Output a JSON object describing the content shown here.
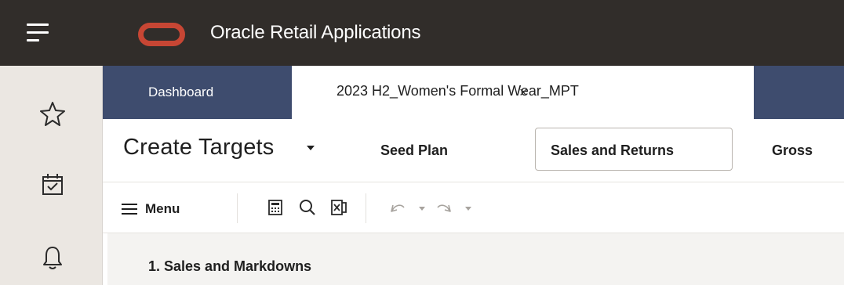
{
  "header": {
    "app_title": "Oracle Retail Applications",
    "menu_icon": "hamburger-icon",
    "logo_icon": "oracle-logo",
    "background": "#312d2a",
    "logo_color": "#c74634"
  },
  "siderail": {
    "items": [
      {
        "icon": "star-icon",
        "label": "Favorites"
      },
      {
        "icon": "calendar-check-icon",
        "label": "Tasks"
      },
      {
        "icon": "bell-icon",
        "label": "Notifications"
      }
    ]
  },
  "tabs": {
    "items": [
      {
        "label": "Dashboard",
        "active": false
      },
      {
        "label": "2023 H2_Women's Formal Wear_MPT",
        "active": true,
        "close": "×"
      }
    ],
    "bar_color": "#3e4c6e"
  },
  "stage": {
    "title": "Create Targets",
    "steps": [
      {
        "label": "Seed Plan",
        "selected": false
      },
      {
        "label": "Sales and Returns",
        "selected": true
      },
      {
        "label": "Gross",
        "selected": false
      }
    ]
  },
  "toolbar": {
    "menu_label": "Menu",
    "icons": [
      "calculator-icon",
      "search-icon",
      "export-excel-icon",
      "undo-icon",
      "redo-icon"
    ]
  },
  "section": {
    "title": "1. Sales and Markdowns"
  }
}
